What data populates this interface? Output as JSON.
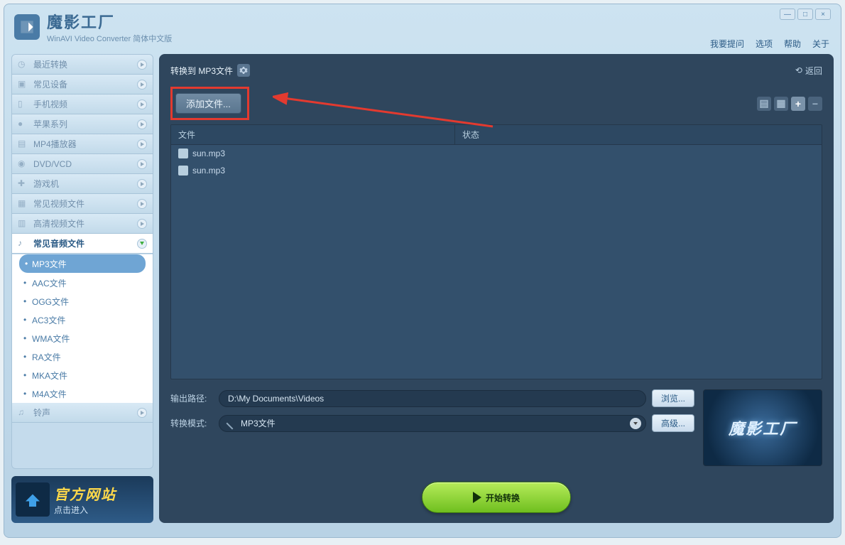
{
  "app": {
    "title": "魔影工厂",
    "subtitle": "WinAVI Video Converter 简体中文版"
  },
  "menu": {
    "ask": "我要提问",
    "options": "选项",
    "help": "帮助",
    "about": "关于"
  },
  "sidebar": {
    "cats": [
      {
        "label": "最近转换"
      },
      {
        "label": "常见设备"
      },
      {
        "label": "手机视频"
      },
      {
        "label": "苹果系列"
      },
      {
        "label": "MP4播放器"
      },
      {
        "label": "DVD/VCD"
      },
      {
        "label": "游戏机"
      },
      {
        "label": "常见视频文件"
      },
      {
        "label": "高清视频文件"
      },
      {
        "label": "常见音频文件"
      },
      {
        "label": "铃声"
      }
    ],
    "audio_sub": [
      {
        "label": "MP3文件",
        "selected": true
      },
      {
        "label": "AAC文件"
      },
      {
        "label": "OGG文件"
      },
      {
        "label": "AC3文件"
      },
      {
        "label": "WMA文件"
      },
      {
        "label": "RA文件"
      },
      {
        "label": "MKA文件"
      },
      {
        "label": "M4A文件"
      }
    ],
    "banner": {
      "title": "官方网站",
      "sub": "点击进入"
    }
  },
  "main": {
    "heading": "转换到 MP3文件",
    "back": "返回",
    "add": "添加文件...",
    "columns": {
      "file": "文件",
      "status": "状态"
    },
    "files": [
      {
        "name": "sun.mp3"
      },
      {
        "name": "sun.mp3"
      }
    ],
    "output": {
      "path_label": "输出路径:",
      "path_value": "D:\\My Documents\\Videos",
      "browse": "浏览...",
      "mode_label": "转换模式:",
      "mode_value": "MP3文件",
      "advanced": "高级..."
    },
    "preview": "魔影工厂",
    "start": "开始转换"
  }
}
